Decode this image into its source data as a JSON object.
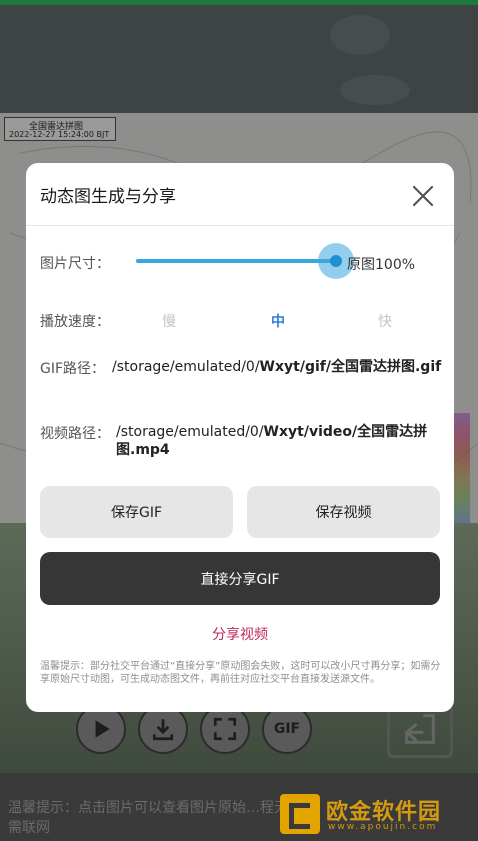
{
  "background": {
    "radar_title": "全国雷达拼图",
    "radar_time": "2022-12-27 15:24:00 BJT",
    "controls": {
      "gif_label": "GIF"
    },
    "hint": "温馨提示：点击图片可以查看图片原始…程无需联网",
    "watermark": {
      "title": "欧金软件园",
      "url": "www.apoujin.com"
    }
  },
  "dialog": {
    "title": "动态图生成与分享",
    "size": {
      "label": "图片尺寸：",
      "value": "原图100%",
      "percent": 100
    },
    "speed": {
      "label": "播放速度：",
      "options": [
        "慢",
        "中",
        "快"
      ],
      "selected": "中"
    },
    "gif_path": {
      "label": "GIF路径：",
      "prefix": "/storage/emulated/0/",
      "bold": "Wxyt/gif/全国雷达拼图.gif"
    },
    "video_path": {
      "label": "视频路径：",
      "prefix": "/storage/emulated/0/",
      "bold": "Wxyt/video/全国雷达拼图.mp4"
    },
    "buttons": {
      "save_gif": "保存GIF",
      "save_video": "保存视频",
      "share_gif": "直接分享GIF",
      "share_video": "分享视频"
    },
    "tip": "温馨提示：部分社交平台通过“直接分享”原动图会失败，这时可以改小尺寸再分享；如需分享原始尺寸动图，可生成动态图文件，再前往对应社交平台直接发送源文件。"
  },
  "colors": {
    "accent": "#3aa7dd",
    "active_speed": "#2f7fcf",
    "link": "#c2285a",
    "dark_button": "#363636"
  }
}
